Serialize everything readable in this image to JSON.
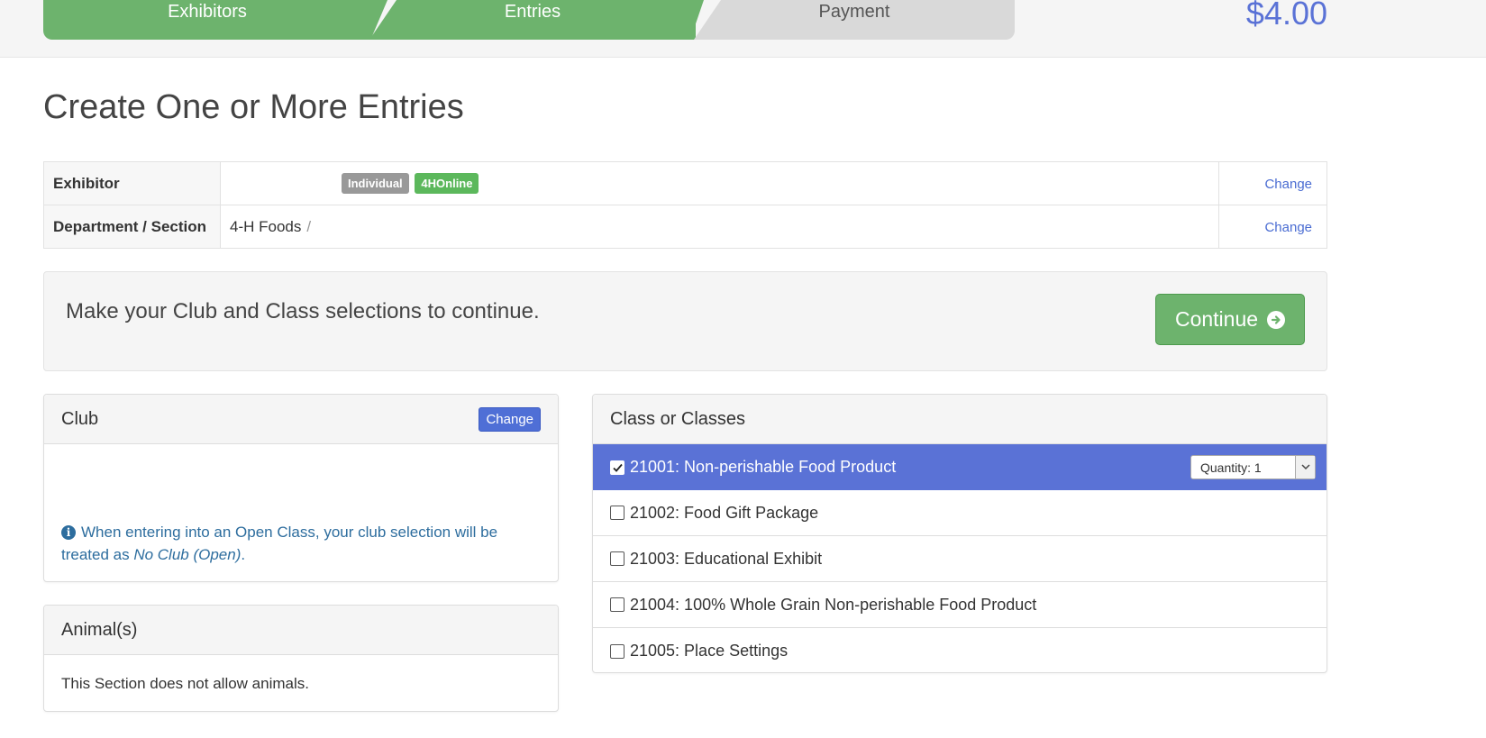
{
  "progress": {
    "steps": [
      {
        "label": "Exhibitors",
        "state": "complete"
      },
      {
        "label": "Entries",
        "state": "current"
      },
      {
        "label": "Payment",
        "state": "pending"
      }
    ],
    "total": "$4.00"
  },
  "page_title": "Create One or More Entries",
  "summary": {
    "exhibitor_label": "Exhibitor",
    "exhibitor_badges": [
      "Individual",
      "4HOnline"
    ],
    "department_label": "Department / Section",
    "department_value": "4-H Foods",
    "department_separator": "/",
    "change_label": "Change"
  },
  "notice": {
    "text": "Make your Club and Class selections to continue.",
    "continue_label": "Continue"
  },
  "club_panel": {
    "title": "Club",
    "change_label": "Change",
    "info_text": "When entering into an Open Class, your club selection will be treated as ",
    "info_emphasis": "No Club (Open)",
    "info_end": "."
  },
  "animals_panel": {
    "title": "Animal(s)",
    "text": "This Section does not allow animals."
  },
  "classes_panel": {
    "title": "Class or Classes",
    "items": [
      {
        "label": "21001: Non-perishable Food Product",
        "checked": true,
        "quantity": "Quantity: 1"
      },
      {
        "label": "21002: Food Gift Package",
        "checked": false
      },
      {
        "label": "21003: Educational Exhibit",
        "checked": false
      },
      {
        "label": "21004: 100% Whole Grain Non-perishable Food Product",
        "checked": false
      },
      {
        "label": "21005: Place Settings",
        "checked": false
      }
    ]
  },
  "colors": {
    "step_complete": "#6db36d",
    "step_pending": "#d9d9d9",
    "accent_blue": "#5a72d6",
    "info_text": "#2d6d9e"
  },
  "icons": {
    "continue": "arrow-circle-right-icon",
    "info": "info-circle-icon",
    "checkbox": "checkbox-icon",
    "dropdown": "chevron-down-icon"
  }
}
